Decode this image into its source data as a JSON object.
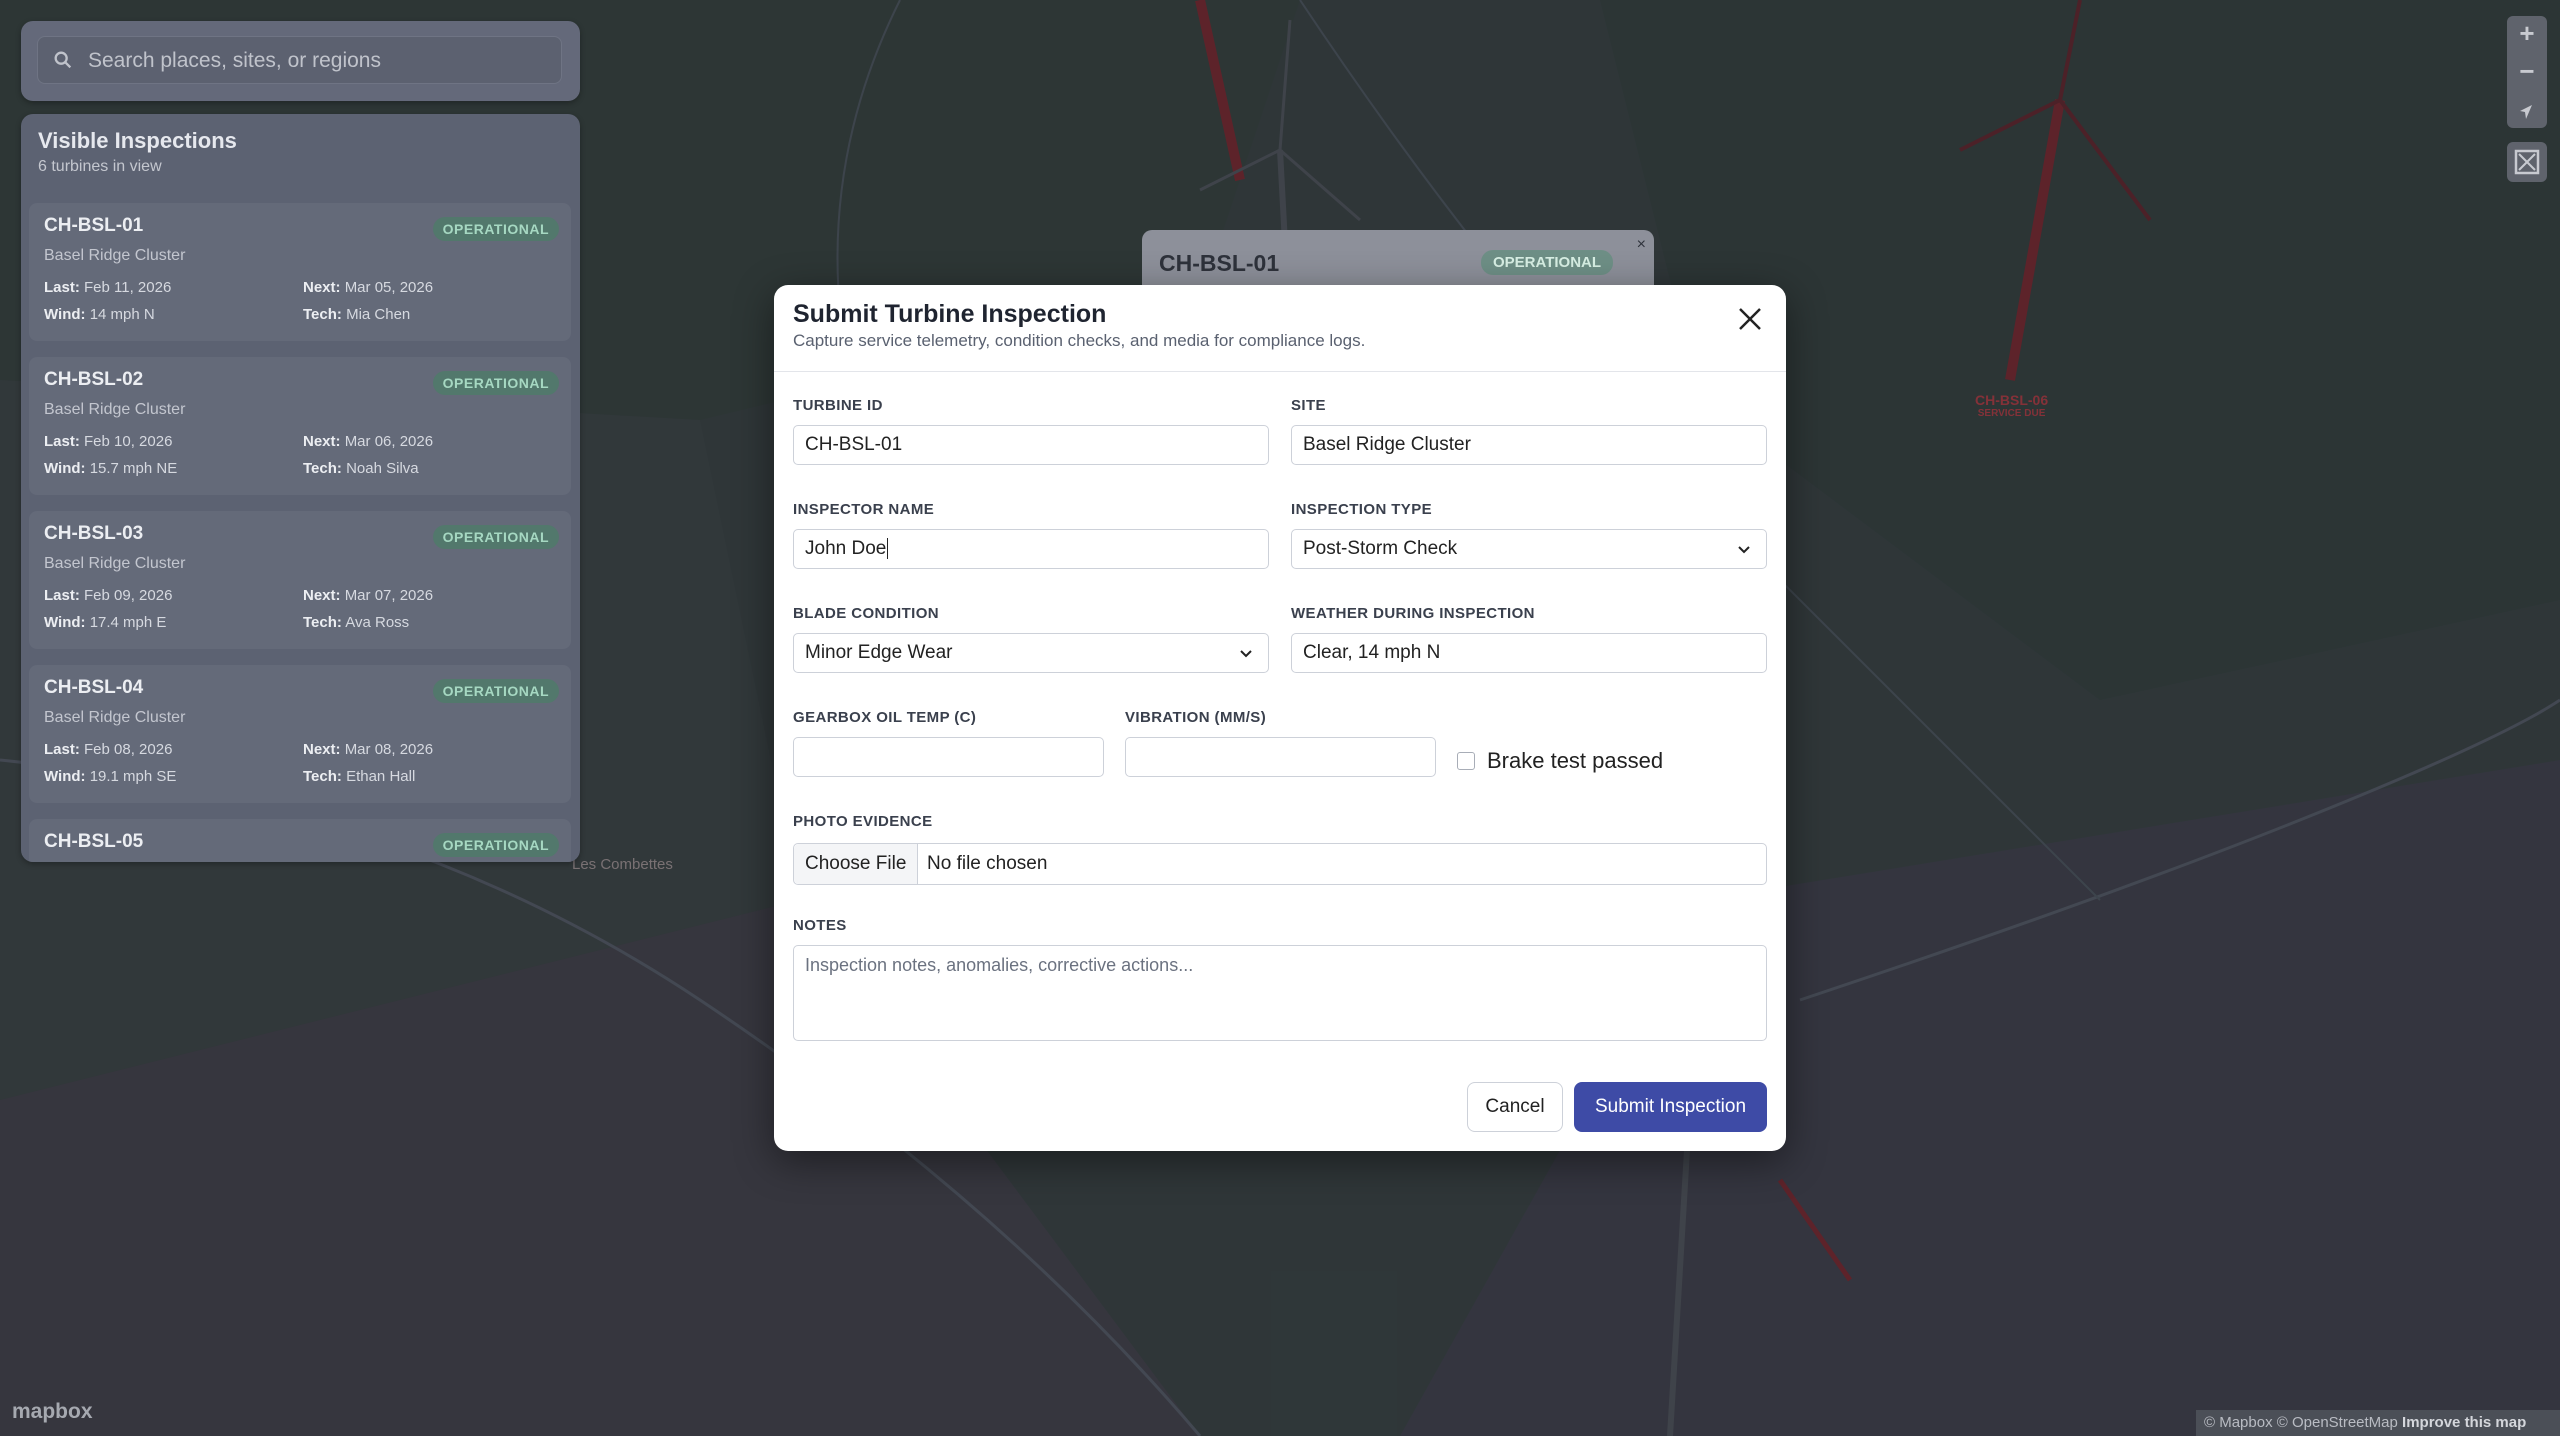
{
  "search": {
    "placeholder": "Search places, sites, or regions"
  },
  "sidebar": {
    "title": "Visible Inspections",
    "subtitle": "6 turbines in view",
    "labels": {
      "last": "Last:",
      "next": "Next:",
      "wind": "Wind:",
      "tech": "Tech:"
    },
    "cards": [
      {
        "id": "CH-BSL-01",
        "status": "OPERATIONAL",
        "site": "Basel Ridge Cluster",
        "last": "Feb 11, 2026",
        "next": "Mar 05, 2026",
        "wind": "14 mph N",
        "tech": "Mia Chen"
      },
      {
        "id": "CH-BSL-02",
        "status": "OPERATIONAL",
        "site": "Basel Ridge Cluster",
        "last": "Feb 10, 2026",
        "next": "Mar 06, 2026",
        "wind": "15.7 mph NE",
        "tech": "Noah Silva"
      },
      {
        "id": "CH-BSL-03",
        "status": "OPERATIONAL",
        "site": "Basel Ridge Cluster",
        "last": "Feb 09, 2026",
        "next": "Mar 07, 2026",
        "wind": "17.4 mph E",
        "tech": "Ava Ross"
      },
      {
        "id": "CH-BSL-04",
        "status": "OPERATIONAL",
        "site": "Basel Ridge Cluster",
        "last": "Feb 08, 2026",
        "next": "Mar 08, 2026",
        "wind": "19.1 mph SE",
        "tech": "Ethan Hall"
      },
      {
        "id": "CH-BSL-05",
        "status": "OPERATIONAL"
      }
    ]
  },
  "popup": {
    "id": "CH-BSL-01",
    "status": "OPERATIONAL",
    "close": "×"
  },
  "modal": {
    "title": "Submit Turbine Inspection",
    "subtitle": "Capture service telemetry, condition checks, and media for compliance logs.",
    "fields": {
      "turbine_id": {
        "label": "TURBINE ID",
        "value": "CH-BSL-01"
      },
      "site": {
        "label": "SITE",
        "value": "Basel Ridge Cluster"
      },
      "inspector_name": {
        "label": "INSPECTOR NAME",
        "value": "John Doe"
      },
      "inspection_type": {
        "label": "INSPECTION TYPE",
        "value": "Post-Storm Check"
      },
      "blade_condition": {
        "label": "BLADE CONDITION",
        "value": "Minor Edge Wear"
      },
      "weather": {
        "label": "WEATHER DURING INSPECTION",
        "value": "Clear, 14 mph N"
      },
      "gearbox_temp": {
        "label": "GEARBOX OIL TEMP (C)",
        "value": ""
      },
      "vibration": {
        "label": "VIBRATION (MM/S)",
        "value": ""
      },
      "brake_test": {
        "label": "Brake test passed",
        "checked": false
      },
      "photo": {
        "label": "PHOTO EVIDENCE",
        "button": "Choose File",
        "status": "No file chosen"
      },
      "notes": {
        "label": "NOTES",
        "placeholder": "Inspection notes, anomalies, corrective actions..."
      }
    },
    "actions": {
      "cancel": "Cancel",
      "submit": "Submit Inspection"
    }
  },
  "map": {
    "place_label": "Les Combettes",
    "turbine_label": "CH-BSL-06",
    "turbine_sublabel": "SERVICE DUE",
    "attribution": "© Mapbox © OpenStreetMap",
    "improve": "Improve this map",
    "logo": "mapbox",
    "zoom_in": "+",
    "zoom_out": "−"
  },
  "colors": {
    "primary": "#3e4ba6",
    "status_operational": "#a6d8c2",
    "service_due": "#c9424a"
  }
}
